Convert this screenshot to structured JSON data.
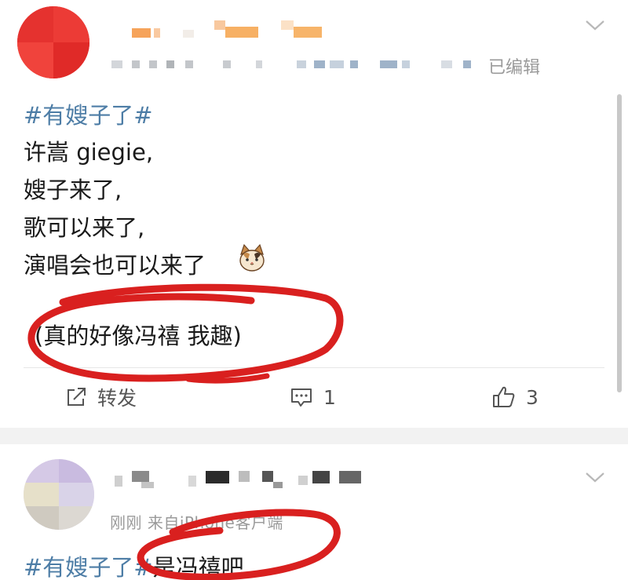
{
  "post1": {
    "edited_label": "已编辑",
    "topic": "#有嫂子了#",
    "lines": [
      "许嵩 giegie,",
      "嫂子来了,",
      "歌可以来了,",
      "演唱会也可以来了",
      "(真的好像冯禧 我趣)"
    ],
    "emoji": "cat-face-emoji",
    "actions": {
      "repost_label": "转发",
      "comment_count": "1",
      "like_count": "3"
    }
  },
  "post2": {
    "meta": "刚刚 来自iPhone客户端",
    "topic": "#有嫂子了#",
    "text": "是冯禧吧"
  },
  "colors": {
    "topic_blue": "#4d7da6",
    "annotation_red": "#d9201f",
    "meta_gray": "#9a9a9a",
    "section_gray": "#f2f2f2"
  }
}
